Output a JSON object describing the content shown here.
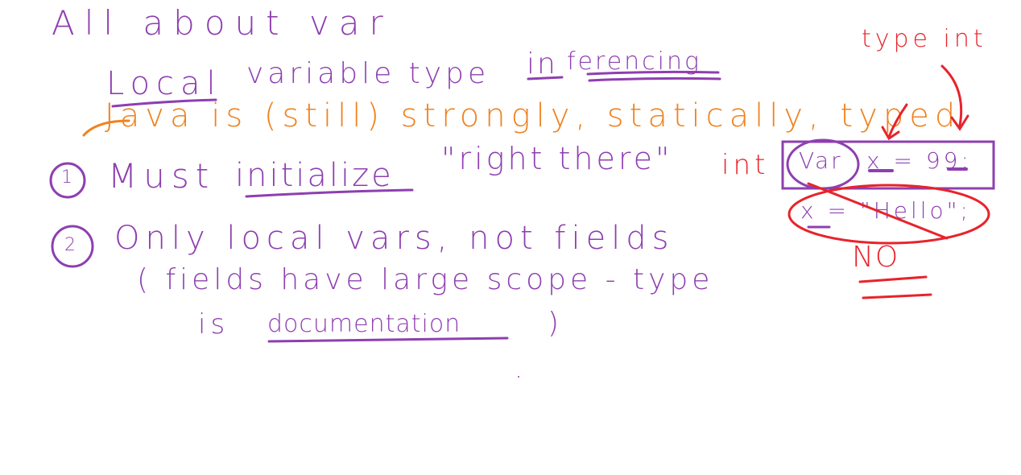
{
  "canvas": {
    "background": "#ffffff",
    "ink_colors": {
      "purple": "#8e3fb1",
      "orange": "#f0821e",
      "red": "#e8232b"
    }
  },
  "notes": {
    "title": "All about var",
    "subtitle_underlined": "Local",
    "subtitle_rest": "variable type",
    "subtitle_in": "in",
    "subtitle_ferencing": "ferencing",
    "java_line": "Java is (still) strongly, statically, typed",
    "point1_marker": "1",
    "point1_a": "Must",
    "point1_b": "initialize",
    "point1_c": "\"right there\"",
    "point2_marker": "2",
    "point2_line1": "Only local vars, not fields",
    "point2_line2": "( fields have large scope - type",
    "point2_line3_a": "is",
    "point2_line3_b": "documentation",
    "point2_line3_c": ")"
  },
  "example": {
    "type_label": "type int",
    "int_label": "int",
    "var_keyword": "Var",
    "decl_rest": "x = 99;",
    "reassign": "x = \"Hello\";",
    "no_label": "NO"
  }
}
